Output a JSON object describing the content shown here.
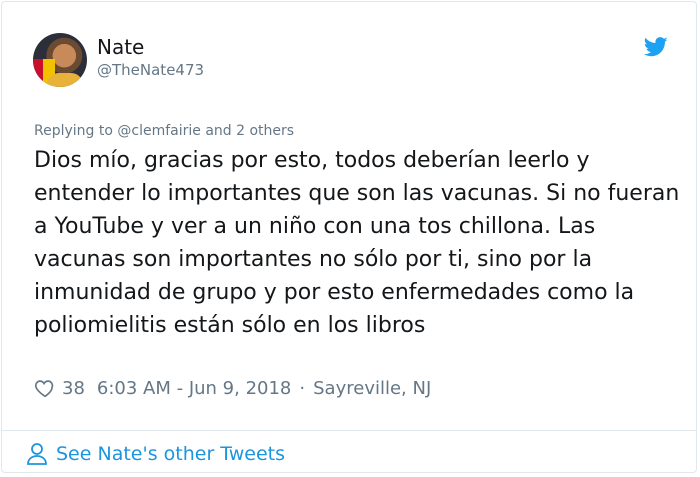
{
  "user": {
    "name": "Nate",
    "handle": "@TheNate473"
  },
  "tweet": {
    "replying_to": "Replying to @clemfairie and 2 others",
    "text": "Dios mío, gracias por esto, todos deberían leerlo y entender lo importantes que son las vacunas. Si no fueran a YouTube y ver a un niño con una tos chillona. Las vacunas son importantes no sólo por ti, sino por la inmunidad de grupo y por esto enfermedades como la poliomielitis están sólo en los libros",
    "likes": "38",
    "timestamp": "6:03 AM - Jun 9, 2018",
    "separator": "·",
    "location": "Sayreville, NJ"
  },
  "footer": {
    "link_label": "See Nate's other Tweets"
  },
  "icons": {
    "brand": "twitter-bird-icon",
    "like": "heart-icon",
    "profile": "person-icon"
  },
  "colors": {
    "twitter_blue": "#1da1f2",
    "link_blue": "#1b95e0",
    "text": "#14171a",
    "muted": "#657786",
    "border": "#e1e8ed"
  }
}
